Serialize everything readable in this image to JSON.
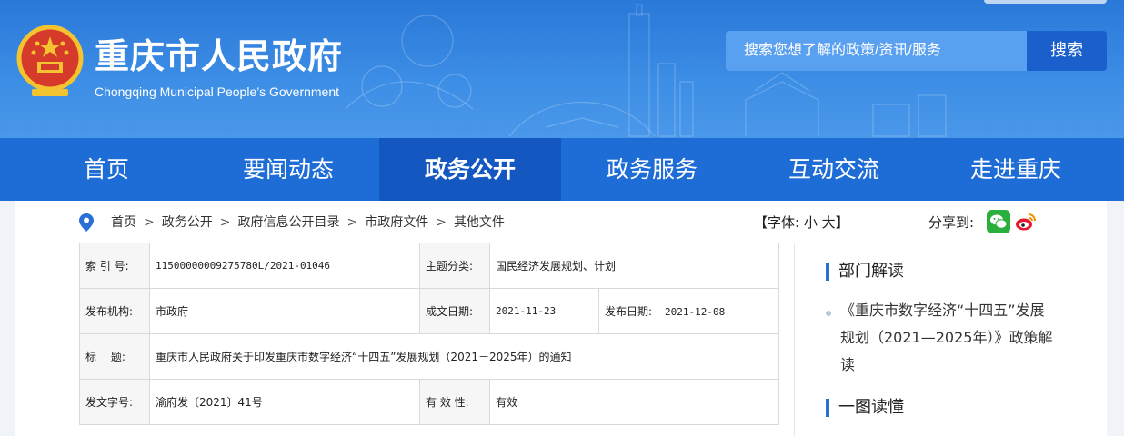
{
  "site": {
    "title": "重庆市人民政府",
    "subtitle": "Chongqing Municipal People’s Government"
  },
  "search": {
    "placeholder": "搜索您想了解的政策/资讯/服务",
    "button": "搜索"
  },
  "nav": {
    "items": [
      {
        "label": "首页"
      },
      {
        "label": "要闻动态"
      },
      {
        "label": "政务公开",
        "active": true
      },
      {
        "label": "政务服务"
      },
      {
        "label": "互动交流"
      },
      {
        "label": "走进重庆"
      }
    ]
  },
  "breadcrumb": {
    "items": [
      "首页",
      "政务公开",
      "政府信息公开目录",
      "市政府文件",
      "其他文件"
    ],
    "separator": ">"
  },
  "font_size": {
    "prefix": "【字体:",
    "small": "小",
    "large": "大",
    "suffix": "】"
  },
  "share": {
    "label": "分享到:",
    "icons": [
      "wechat-icon",
      "weibo-icon"
    ]
  },
  "meta": {
    "index_label": "索 引 号:",
    "index_value": "11500000009275780L/2021-01046",
    "topic_label": "主题分类:",
    "topic_value": "国民经济发展规划、计划",
    "publisher_label": "发布机构:",
    "publisher_value": "市政府",
    "written_label": "成文日期:",
    "written_value": "2021-11-23",
    "published_label": "发布日期:",
    "published_value": "2021-12-08",
    "title_label": "标　 题:",
    "title_value": "重庆市人民政府关于印发重庆市数字经济“十四五”发展规划（2021－2025年）的通知",
    "docno_label": "发文字号:",
    "docno_value": "渝府发〔2021〕41号",
    "validity_label": "有 效 性:",
    "validity_value": "有效"
  },
  "sidebar": {
    "section1": "部门解读",
    "link1": "《重庆市数字经济“十四五”发展规划（2021—2025年）》政策解读",
    "section2": "一图读懂"
  },
  "colors": {
    "header_blue": "#2a78d8",
    "nav_blue": "#1e6cd6",
    "nav_active": "#1557c0",
    "search_button": "#1a5fcb",
    "accent_bar": "#2a6fd6"
  }
}
